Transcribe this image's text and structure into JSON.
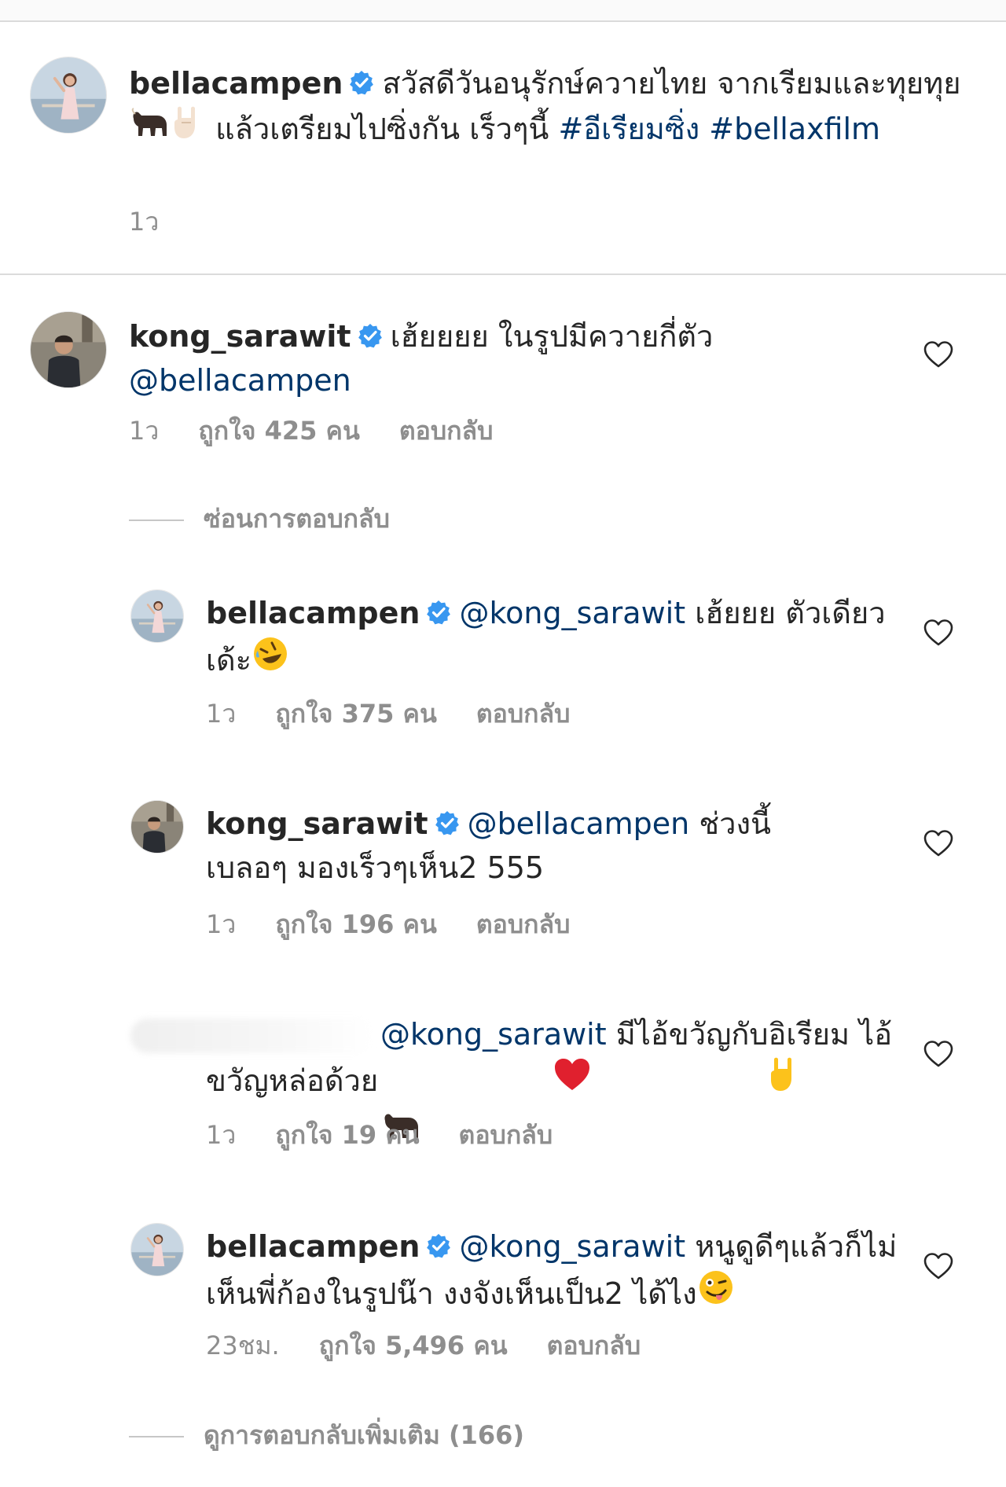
{
  "caption": {
    "username": "bellacampen",
    "text_part1": "สวัสดีวันอนุรักษ์ควายไทย จากเรียมและทุยทุย",
    "text_part2": "แล้วเตรียมไปซิ่งกัน เร็วๆนี้",
    "hashtag1": "#อีเรียมซิ่ง",
    "hashtag2": "#bellaxfilm",
    "time": "1ว"
  },
  "comments": [
    {
      "username": "kong_sarawit",
      "text": "เฮ้ยยยย ในรูปมีควายกี่ตัว",
      "mention": "@bellacampen",
      "time": "1ว",
      "likes": "ถูกใจ 425 คน",
      "reply": "ตอบกลับ"
    }
  ],
  "hide_replies": "ซ่อนการตอบกลับ",
  "replies": [
    {
      "username": "bellacampen",
      "mention": "@kong_sarawit",
      "text": "เฮ้ยยย ตัวเดียวเด้ะ",
      "time": "1ว",
      "likes": "ถูกใจ 375 คน",
      "reply": "ตอบกลับ"
    },
    {
      "username": "kong_sarawit",
      "mention": "@bellacampen",
      "text": "ช่วงนี้เบลอๆ มองเร็วๆเห็น2 555",
      "time": "1ว",
      "likes": "ถูกใจ 196 คน",
      "reply": "ตอบกลับ"
    },
    {
      "username": "",
      "mention": "@kong_sarawit",
      "text": "มีไอ้ขวัญกับอิเรียม ไอ้ขวัญหล่อด้วย",
      "time": "1ว",
      "likes": "ถูกใจ 19 คน",
      "reply": "ตอบกลับ"
    },
    {
      "username": "bellacampen",
      "mention": "@kong_sarawit",
      "text": "หนูดูดีๆแล้วก็ไม่เห็นพี่ก้องในรูปน๊า งงจังเห็นเป็น2 ได้ไง",
      "time": "23ชม.",
      "likes": "ถูกใจ 5,496 คน",
      "reply": "ตอบกลับ"
    }
  ],
  "more_replies": "ดูการตอบกลับเพิ่มเติม (166)",
  "colors": {
    "text": "#262626",
    "secondary": "#8e8e8e",
    "link": "#003569",
    "verified": "#3897f0",
    "divider": "#dbdbdb"
  },
  "icons": [
    "verified-badge-icon",
    "heart-icon",
    "ox-emoji",
    "rock-hand-emoji",
    "rofl-emoji",
    "red-heart-emoji",
    "zany-face-emoji"
  ]
}
